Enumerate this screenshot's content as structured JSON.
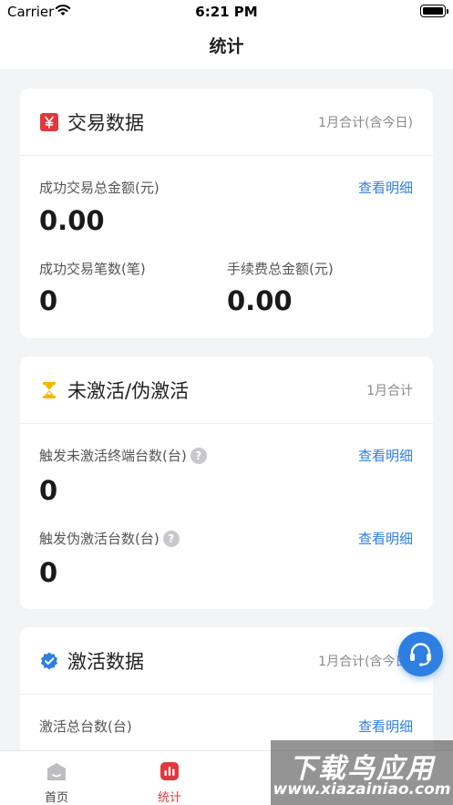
{
  "status_bar": {
    "carrier": "Carrier",
    "time": "6:21 PM"
  },
  "nav": {
    "title": "统计"
  },
  "cards": {
    "trade": {
      "title": "交易数据",
      "period": "1月合计(含今日)",
      "total_amount_label": "成功交易总金额(元)",
      "total_amount_value": "0.00",
      "detail_link": "查看明细",
      "count_label": "成功交易笔数(笔)",
      "count_value": "0",
      "fee_label": "手续费总金额(元)",
      "fee_value": "0.00"
    },
    "inactive": {
      "title": "未激活/伪激活",
      "period": "1月合计",
      "inactive_label": "触发未激活终端台数(台)",
      "inactive_value": "0",
      "inactive_link": "查看明细",
      "fake_label": "触发伪激活台数(台)",
      "fake_value": "0",
      "fake_link": "查看明细",
      "help_glyph": "?"
    },
    "activation": {
      "title": "激活数据",
      "period": "1月合计(含今日)",
      "total_label": "激活总台数(台)",
      "detail_link": "查看明细"
    }
  },
  "tabs": [
    {
      "label": "首页",
      "icon": "home-icon",
      "active": false
    },
    {
      "label": "统计",
      "icon": "stats-icon",
      "active": true
    }
  ],
  "watermark": {
    "main": "下载鸟应用",
    "sub": "www.xiazainiao.com"
  },
  "colors": {
    "accent": "#2f7fe2",
    "brand_red": "#e0383e",
    "hourglass": "#f5b800"
  }
}
